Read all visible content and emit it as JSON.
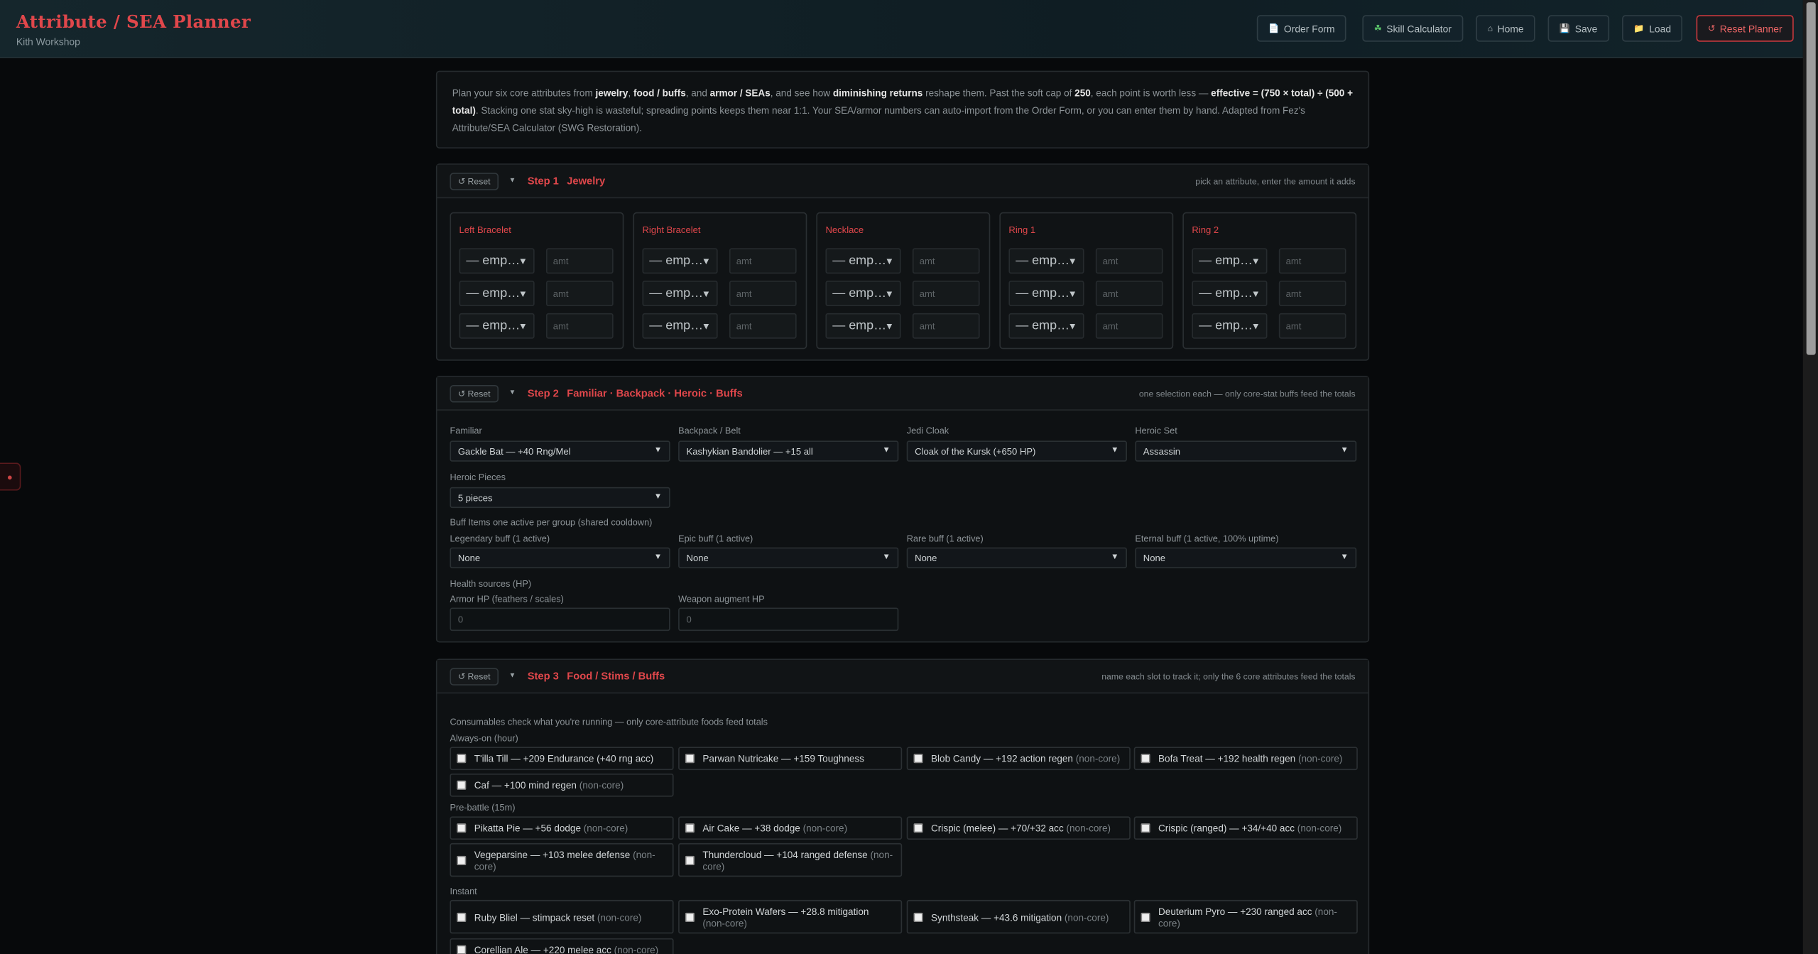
{
  "header": {
    "title": "Attribute / SEA Planner",
    "subtitle": "Kith Workshop",
    "buttons": [
      {
        "icon": "document-icon",
        "glyph": "📄",
        "label": "Order Form"
      },
      {
        "icon": "gem-icon",
        "glyph": "☘",
        "label": "Skill Calculator"
      },
      {
        "icon": "home-icon",
        "glyph": "⌂",
        "label": "Home"
      },
      {
        "icon": "floppy-disk-icon",
        "glyph": "💾",
        "label": "Save"
      },
      {
        "icon": "folder-icon",
        "glyph": "📁",
        "label": "Load"
      },
      {
        "icon": "reset-icon",
        "glyph": "↺",
        "label": "Reset Planner"
      }
    ]
  },
  "intro": {
    "t1": "Plan your six core attributes from ",
    "b1": "jewelry",
    "t2": ", ",
    "b2": "food / buffs",
    "t3": ", and ",
    "b3": "armor / SEAs",
    "t4": ", and see how ",
    "b4": "diminishing returns",
    "t5": " reshape them. Past the soft cap of ",
    "b5": "250",
    "t6": ", each point is worth less — ",
    "b6": "effective = (750 × total) ÷ (500 + total)",
    "t7": ". Stacking one stat sky-high is wasteful; spreading points keeps them near 1:1. Your SEA/armor numbers can auto-import from the Order Form, or you can enter them by hand. Adapted from Fez's Attribute/SEA Calculator (SWG Restoration)."
  },
  "common": {
    "reset": "↺ Reset",
    "caret": "▼",
    "dd": "▼",
    "empty": "— empty —",
    "amt_placeholder": "amt"
  },
  "step1": {
    "step": "Step 1",
    "title": "Jewelry",
    "hint": "pick an attribute, enter the amount it adds",
    "slots": [
      "Left Bracelet",
      "Right Bracelet",
      "Necklace",
      "Ring 1",
      "Ring 2"
    ]
  },
  "step2": {
    "step": "Step 2",
    "title": "Familiar · Backpack · Heroic · Buffs",
    "hint": "one selection each — only core-stat buffs feed the totals",
    "familiar": {
      "label": "Familiar",
      "value": "Gackle Bat — +40 Rng/Mel"
    },
    "backpack": {
      "label": "Backpack / Belt",
      "value": "Kashykian Bandolier — +15 all"
    },
    "cloak": {
      "label": "Jedi Cloak",
      "value": "Cloak of the Kursk (+650 HP)"
    },
    "heroic_set": {
      "label": "Heroic Set",
      "value": "Assassin"
    },
    "heroic_pieces": {
      "label": "Heroic Pieces",
      "value": "5 pieces"
    },
    "buff_items": "Buff Items one active per group (shared cooldown)",
    "legendary": {
      "label": "Legendary buff (1 active)",
      "value": "None"
    },
    "epic": {
      "label": "Epic buff (1 active)",
      "value": "None"
    },
    "rare": {
      "label": "Rare buff (1 active)",
      "value": "None"
    },
    "eternal": {
      "label": "Eternal buff (1 active, 100% uptime)",
      "value": "None"
    },
    "health_sources": "Health sources (HP)",
    "armor_hp": {
      "label": "Armor HP (feathers / scales)",
      "placeholder": "0"
    },
    "weapon_hp": {
      "label": "Weapon augment HP",
      "placeholder": "0"
    }
  },
  "step3": {
    "step": "Step 3",
    "title": "Food / Stims / Buffs",
    "hint": "name each slot to track it; only the 6 core attributes feed the totals",
    "consumables": "Consumables check what you're running — only core-attribute foods feed totals",
    "always_on": "Always-on (hour)",
    "pre_battle": "Pre-battle (15m)",
    "instant": "Instant",
    "noncore": "(non-core)",
    "items": {
      "tilla": "T'illa Till — +209 Endurance (+40 rng acc)",
      "parwan": "Parwan Nutricake — +159 Toughness",
      "blob": "Blob Candy — +192 action regen",
      "bofa": "Bofa Treat — +192 health regen",
      "caf": "Caf — +100 mind regen",
      "pikatta": "Pikatta Pie — +56 dodge",
      "aircake": "Air Cake — +38 dodge",
      "crispic_m": "Crispic (melee) — +70/+32 acc",
      "crispic_r": "Crispic (ranged) — +34/+40 acc",
      "vege": "Vegeparsine — +103 melee defense",
      "thunder": "Thundercloud — +104 ranged defense",
      "ruby": "Ruby Bliel — stimpack reset",
      "exo": "Exo-Protein Wafers — +28.8 mitigation",
      "synth": "Synthsteak — +43.6 mitigation",
      "deut": "Deuterium Pyro — +230 ranged acc",
      "corel": "Corellian Ale — +220 melee acc"
    }
  }
}
